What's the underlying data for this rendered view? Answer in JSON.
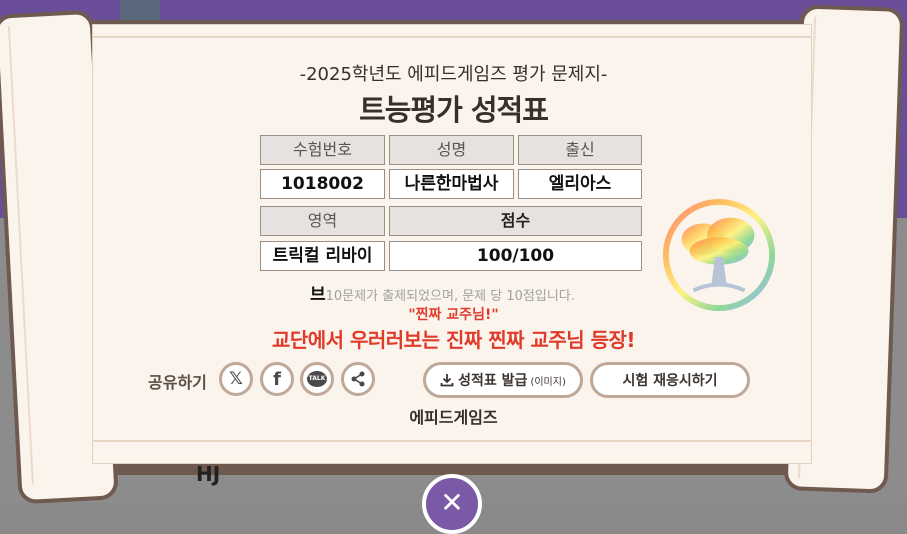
{
  "header": {
    "subtitle": "-2025학년도 에피드게임즈 평가 문제지-",
    "title": "트능평가 성적표"
  },
  "table": {
    "row1_headers": [
      "수험번호",
      "성명",
      "출신"
    ],
    "row1_values": [
      "1018002",
      "나른한마법사",
      "엘리아스"
    ],
    "row2_headers": [
      "영역",
      "점수"
    ],
    "row2_values": [
      "트릭컬 리바이",
      "100/100"
    ]
  },
  "notice": {
    "prefix": "브",
    "text": "10문제가 출제되었으며, 문제 당 10점입니다."
  },
  "result": {
    "quote": "\"찐짜 교주님!\"",
    "praise": "교단에서 우러러보는 진짜 찐짜 교주님 등장!"
  },
  "share": {
    "label": "공유하기",
    "buttons": [
      {
        "icon": "x-icon",
        "glyph": "𝕏"
      },
      {
        "icon": "facebook-icon",
        "glyph": "f"
      },
      {
        "icon": "kakaotalk-icon",
        "glyph": "TALK"
      },
      {
        "icon": "share-icon",
        "glyph": ""
      }
    ]
  },
  "actions": {
    "download_label": "성적표 발급",
    "download_sub": "(이미지)",
    "retry_label": "시험 재응시하기"
  },
  "footer": {
    "brand": "에피드게임즈"
  },
  "bottom_partial_text": "HJ",
  "colors": {
    "accent_red": "#e03b2a",
    "purple": "#7a5aa6",
    "button_border": "#bfa898",
    "paper": "#fbf4ec"
  }
}
